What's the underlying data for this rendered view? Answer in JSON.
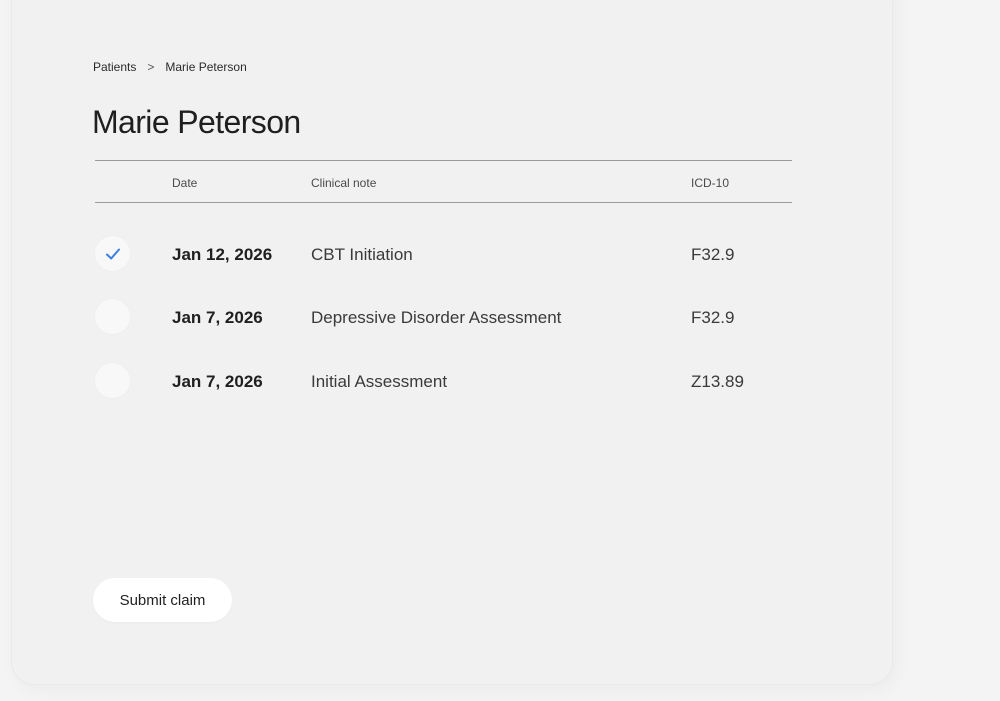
{
  "breadcrumb": {
    "parent": "Patients",
    "separator": ">",
    "current": "Marie Peterson"
  },
  "page_title": "Marie Peterson",
  "table": {
    "headers": {
      "date": "Date",
      "note": "Clinical note",
      "icd": "ICD-10"
    },
    "rows": [
      {
        "date": "Jan 12, 2026",
        "note": "CBT Initiation",
        "icd": "F32.9",
        "checked": true
      },
      {
        "date": "Jan 7, 2026",
        "note": "Depressive Disorder Assessment",
        "icd": "F32.9",
        "checked": false
      },
      {
        "date": "Jan 7, 2026",
        "note": "Initial Assessment",
        "icd": "Z13.89",
        "checked": false
      }
    ]
  },
  "submit_label": "Submit claim",
  "icons": {
    "check": "checkmark-icon"
  },
  "colors": {
    "check_accent": "#3d7fe0",
    "background": "#f1f1f1",
    "button_bg": "#ffffff"
  }
}
